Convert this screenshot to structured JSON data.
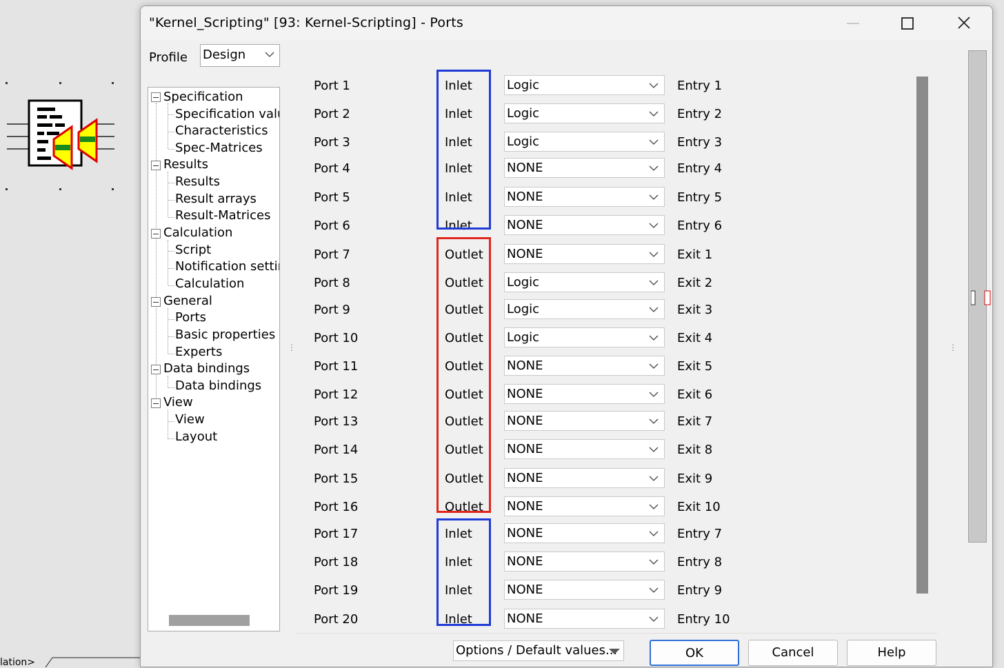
{
  "window": {
    "title": "\"Kernel_Scripting\" [93: Kernel-Scripting] - Ports"
  },
  "background": {
    "bottom_tab_label": "lation>"
  },
  "profile": {
    "label": "Profile",
    "value": "Design"
  },
  "tree": {
    "groups": [
      {
        "label": "Specification",
        "children": [
          "Specification values",
          "Characteristics",
          "Spec-Matrices"
        ]
      },
      {
        "label": "Results",
        "children": [
          "Results",
          "Result arrays",
          "Result-Matrices"
        ]
      },
      {
        "label": "Calculation",
        "children": [
          "Script",
          "Notification settings",
          "Calculation"
        ]
      },
      {
        "label": "General",
        "children": [
          "Ports",
          "Basic properties",
          "Experts"
        ]
      },
      {
        "label": "Data bindings",
        "children": [
          "Data bindings"
        ]
      },
      {
        "label": "View",
        "children": [
          "View",
          "Layout"
        ]
      }
    ],
    "selected": "Ports"
  },
  "ports": [
    {
      "name": "Port 1",
      "direction": "Inlet",
      "type": "Logic",
      "connection": "Entry 1"
    },
    {
      "name": "Port 2",
      "direction": "Inlet",
      "type": "Logic",
      "connection": "Entry 2"
    },
    {
      "name": "Port 3",
      "direction": "Inlet",
      "type": "Logic",
      "connection": "Entry 3"
    },
    {
      "name": "Port 4",
      "direction": "Inlet",
      "type": "NONE",
      "connection": "Entry 4"
    },
    {
      "name": "Port 5",
      "direction": "Inlet",
      "type": "NONE",
      "connection": "Entry 5"
    },
    {
      "name": "Port 6",
      "direction": "Inlet",
      "type": "NONE",
      "connection": "Entry 6"
    },
    {
      "name": "Port 7",
      "direction": "Outlet",
      "type": "NONE",
      "connection": "Exit 1"
    },
    {
      "name": "Port 8",
      "direction": "Outlet",
      "type": "Logic",
      "connection": "Exit 2"
    },
    {
      "name": "Port 9",
      "direction": "Outlet",
      "type": "Logic",
      "connection": "Exit 3"
    },
    {
      "name": "Port 10",
      "direction": "Outlet",
      "type": "Logic",
      "connection": "Exit 4"
    },
    {
      "name": "Port 11",
      "direction": "Outlet",
      "type": "NONE",
      "connection": "Exit 5"
    },
    {
      "name": "Port 12",
      "direction": "Outlet",
      "type": "NONE",
      "connection": "Exit 6"
    },
    {
      "name": "Port 13",
      "direction": "Outlet",
      "type": "NONE",
      "connection": "Exit 7"
    },
    {
      "name": "Port 14",
      "direction": "Outlet",
      "type": "NONE",
      "connection": "Exit 8"
    },
    {
      "name": "Port 15",
      "direction": "Outlet",
      "type": "NONE",
      "connection": "Exit 9"
    },
    {
      "name": "Port 16",
      "direction": "Outlet",
      "type": "NONE",
      "connection": "Exit 10"
    },
    {
      "name": "Port 17",
      "direction": "Inlet",
      "type": "NONE",
      "connection": "Entry 7"
    },
    {
      "name": "Port 18",
      "direction": "Inlet",
      "type": "NONE",
      "connection": "Entry 8"
    },
    {
      "name": "Port 19",
      "direction": "Inlet",
      "type": "NONE",
      "connection": "Entry 9"
    },
    {
      "name": "Port 20",
      "direction": "Inlet",
      "type": "NONE",
      "connection": "Entry 10"
    }
  ],
  "buttons": {
    "options": "Options / Default values...",
    "ok": "OK",
    "cancel": "Cancel",
    "help": "Help"
  },
  "colors": {
    "inlet_group_border": "#1f3bd6",
    "outlet_group_border": "#e0261e",
    "icon_yellow": "#ffff00",
    "icon_green": "#1a8a1a",
    "icon_red": "#e00000"
  }
}
